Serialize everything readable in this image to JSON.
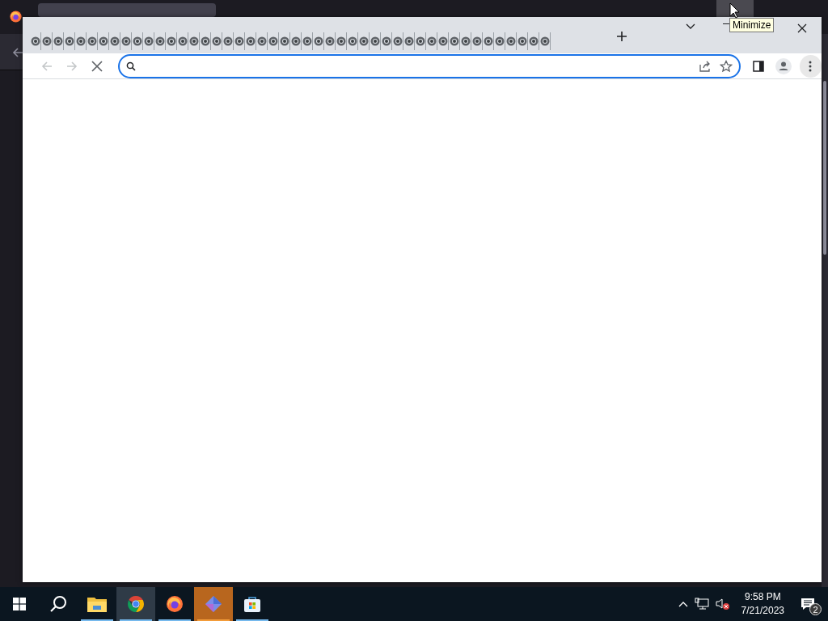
{
  "browser": {
    "tabs": [
      {
        "kind": "favicon"
      },
      {
        "kind": "favicon"
      },
      {
        "kind": "favicon"
      },
      {
        "kind": "favicon"
      },
      {
        "kind": "favicon"
      },
      {
        "kind": "favicon"
      },
      {
        "kind": "favicon"
      },
      {
        "kind": "favicon"
      },
      {
        "kind": "favicon"
      },
      {
        "kind": "favicon"
      },
      {
        "kind": "favicon"
      },
      {
        "kind": "favicon"
      },
      {
        "kind": "favicon"
      },
      {
        "kind": "favicon"
      },
      {
        "kind": "favicon"
      },
      {
        "kind": "favicon"
      },
      {
        "kind": "favicon"
      },
      {
        "kind": "favicon"
      },
      {
        "kind": "favicon"
      },
      {
        "kind": "favicon"
      },
      {
        "kind": "favicon"
      },
      {
        "kind": "favicon"
      },
      {
        "kind": "favicon"
      },
      {
        "kind": "favicon"
      },
      {
        "kind": "favicon"
      },
      {
        "kind": "favicon"
      },
      {
        "kind": "favicon"
      },
      {
        "kind": "favicon"
      },
      {
        "kind": "favicon"
      },
      {
        "kind": "favicon"
      },
      {
        "kind": "favicon"
      },
      {
        "kind": "favicon"
      },
      {
        "kind": "favicon"
      },
      {
        "kind": "favicon"
      },
      {
        "kind": "favicon"
      },
      {
        "kind": "favicon"
      },
      {
        "kind": "favicon"
      },
      {
        "kind": "favicon"
      },
      {
        "kind": "favicon"
      },
      {
        "kind": "favicon"
      },
      {
        "kind": "favicon"
      },
      {
        "kind": "favicon"
      },
      {
        "kind": "favicon"
      },
      {
        "kind": "favicon"
      },
      {
        "kind": "favicon"
      },
      {
        "kind": "favicon"
      }
    ],
    "back": {
      "disabled": true
    },
    "forward": {
      "disabled": true
    },
    "loading": true
  },
  "tooltip": {
    "text": "Minimize"
  },
  "taskbar": {
    "apps": [
      {
        "kind": "start",
        "running": false,
        "selected": false,
        "attention": false
      },
      {
        "kind": "search",
        "running": false,
        "selected": false,
        "attention": false
      },
      {
        "kind": "files",
        "running": true,
        "selected": false,
        "attention": false
      },
      {
        "kind": "chrome",
        "running": true,
        "selected": true,
        "attention": false
      },
      {
        "kind": "firefox",
        "running": true,
        "selected": false,
        "attention": false
      },
      {
        "kind": "prism",
        "running": true,
        "selected": false,
        "attention": true
      },
      {
        "kind": "store",
        "running": true,
        "selected": false,
        "attention": false
      }
    ],
    "clock": {
      "time": "9:58 PM",
      "date": "7/21/2023"
    },
    "notifications": {
      "count": "2"
    }
  }
}
